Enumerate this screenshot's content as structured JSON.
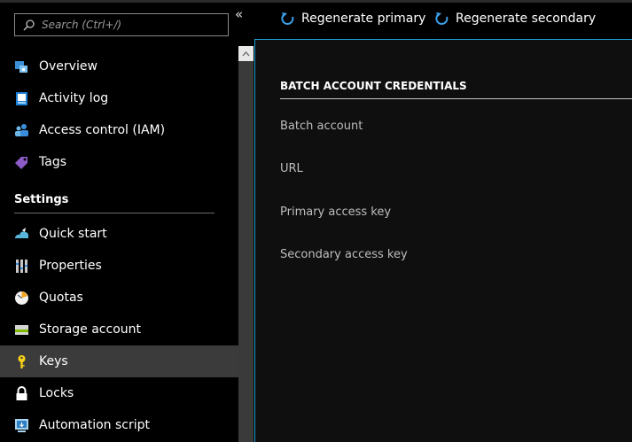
{
  "search": {
    "placeholder": "Search (Ctrl+/)"
  },
  "sidebar": {
    "collapse_glyph": "«",
    "items": [
      {
        "label": "Overview",
        "icon": "overview-icon"
      },
      {
        "label": "Activity log",
        "icon": "activity-log-icon"
      },
      {
        "label": "Access control (IAM)",
        "icon": "access-control-icon"
      },
      {
        "label": "Tags",
        "icon": "tag-icon"
      }
    ],
    "settings_header": "Settings",
    "settings_items": [
      {
        "label": "Quick start",
        "icon": "quick-start-icon"
      },
      {
        "label": "Properties",
        "icon": "properties-icon"
      },
      {
        "label": "Quotas",
        "icon": "quotas-icon"
      },
      {
        "label": "Storage account",
        "icon": "storage-account-icon"
      },
      {
        "label": "Keys",
        "icon": "key-icon",
        "selected": true
      },
      {
        "label": "Locks",
        "icon": "lock-icon"
      },
      {
        "label": "Automation script",
        "icon": "automation-script-icon"
      }
    ]
  },
  "toolbar": {
    "regenerate_primary": "Regenerate primary",
    "regenerate_secondary": "Regenerate secondary"
  },
  "credentials": {
    "header": "BATCH ACCOUNT CREDENTIALS",
    "fields": [
      {
        "label": "Batch account"
      },
      {
        "label": "URL"
      },
      {
        "label": "Primary access key"
      },
      {
        "label": "Secondary access key"
      }
    ]
  },
  "colors": {
    "accent": "#1c9fd4",
    "selected_bg": "#3b3b3b"
  }
}
